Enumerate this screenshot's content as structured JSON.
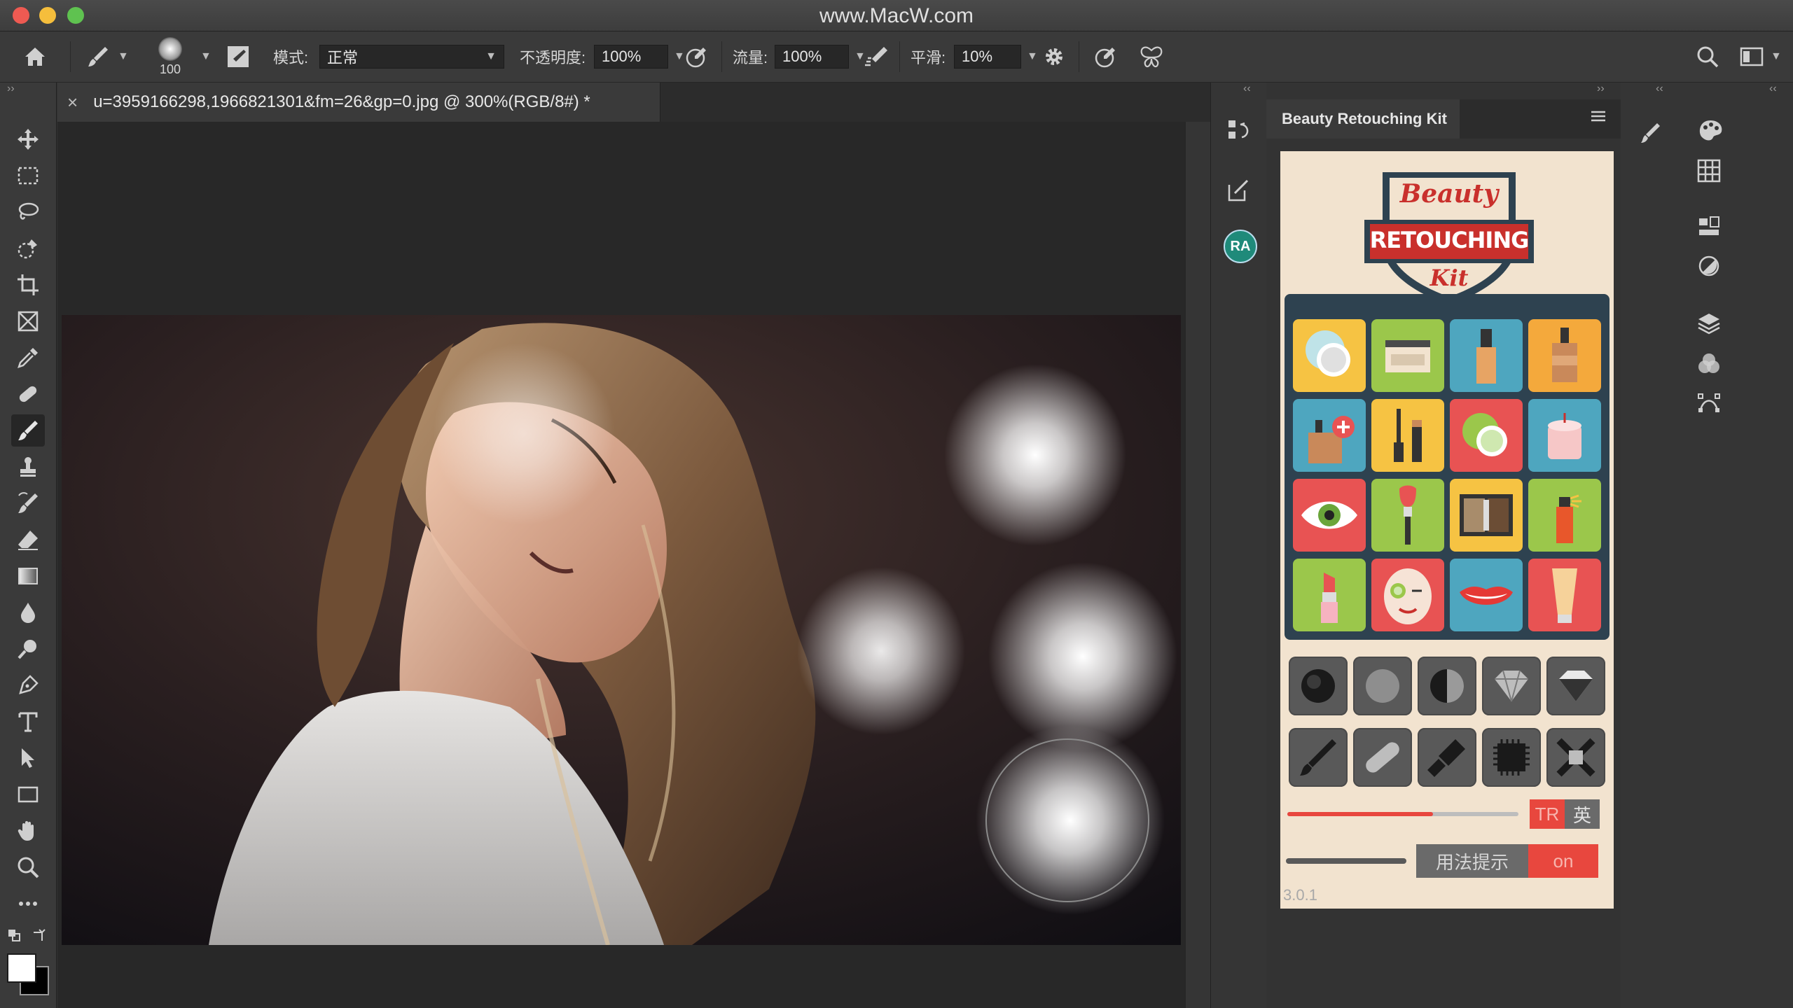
{
  "window": {
    "title": "www.MacW.com"
  },
  "options_bar": {
    "brush_size": "100",
    "mode_label": "模式:",
    "mode_value": "正常",
    "opacity_label": "不透明度:",
    "opacity_value": "100%",
    "flow_label": "流量:",
    "flow_value": "100%",
    "smoothing_label": "平滑:",
    "smoothing_value": "10%"
  },
  "document": {
    "tab_close": "×",
    "tab_title": "u=3959166298,1966821301&fm=26&gp=0.jpg @ 300%(RGB/8#) *"
  },
  "panels": {
    "plugin_tab": "Beauty Retouching Kit",
    "collapse_left": "‹‹",
    "collapse_right": "››",
    "ra_badge": "RA"
  },
  "plugin": {
    "logo_top": "Beauty",
    "logo_main": "RETOUCHING",
    "logo_bottom": "Kit",
    "lang_tr": "TR",
    "lang_en": "英",
    "hint_button": "用法提示",
    "on_button": "on",
    "version": "3.0.1",
    "slider_value": 0.63
  },
  "colors": {
    "accent_red": "#e8473e",
    "tile_yellow": "#f6c343",
    "tile_green": "#9bc74b",
    "tile_blue": "#4ea6bf",
    "tile_orange": "#f4a93c",
    "tile_red": "#e85353",
    "card_bg": "#f2e3cf",
    "grid_bg": "#2e4250"
  }
}
